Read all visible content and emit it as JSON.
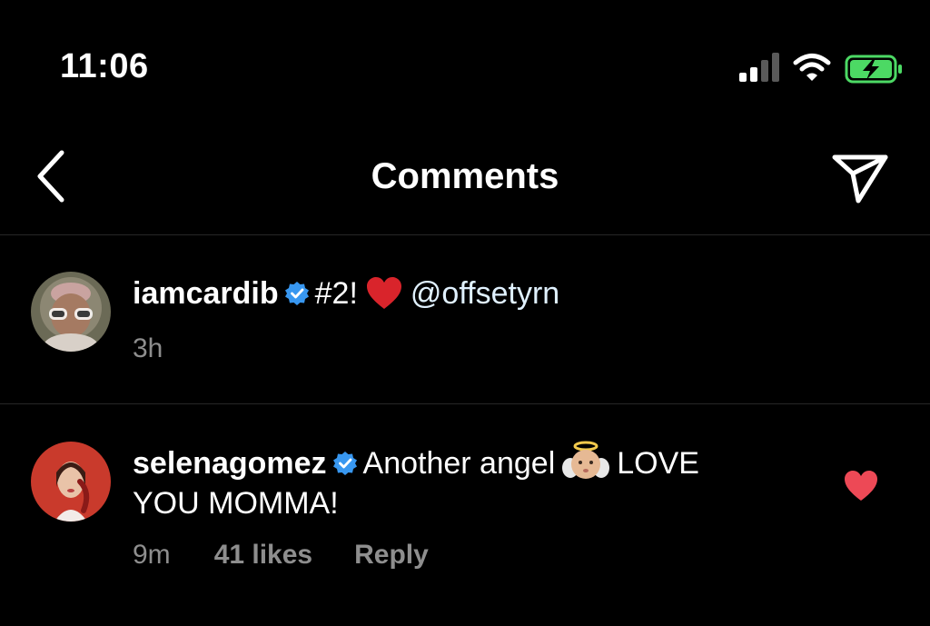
{
  "status_bar": {
    "time": "11:06",
    "icons": [
      "signal-icon",
      "wifi-icon",
      "battery-charging-icon"
    ],
    "battery_color": "#4cd964"
  },
  "header": {
    "title": "Comments",
    "back_icon": "chevron-left-icon",
    "share_icon": "paper-plane-icon"
  },
  "comments": [
    {
      "username": "iamcardib",
      "verified": true,
      "text_before": "#2!",
      "emoji": "red-heart-emoji",
      "mention": "@offsetyrn",
      "time": "3h"
    },
    {
      "username": "selenagomez",
      "verified": true,
      "text_before": "Another angel",
      "emoji": "baby-angel-emoji",
      "text_after": "LOVE",
      "text_line2": "YOU MOMMA!",
      "time": "9m",
      "likes": "41 likes",
      "reply": "Reply",
      "liked": true
    }
  ],
  "colors": {
    "background": "#000000",
    "text": "#ffffff",
    "secondary_text": "#8e8e8e",
    "verified_blue": "#3897f0",
    "like_red": "#ed4956",
    "divider": "#262626"
  }
}
